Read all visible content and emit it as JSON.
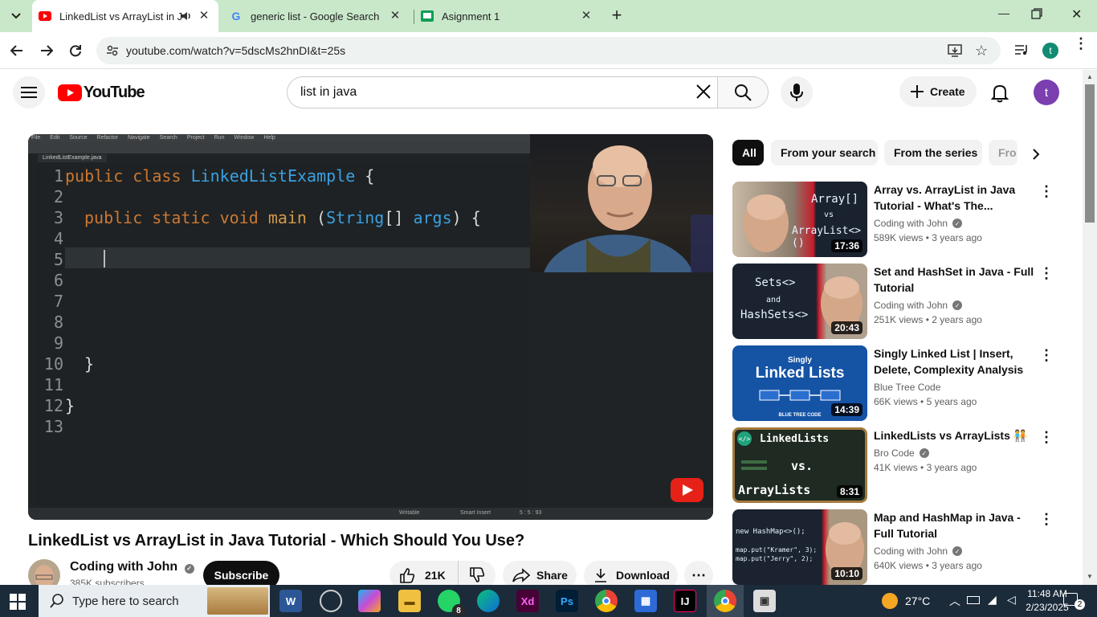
{
  "browser": {
    "tabs": [
      {
        "title": "LinkedList vs ArrayList in Jav",
        "active": true
      },
      {
        "title": "generic list - Google Search",
        "active": false
      },
      {
        "title": "Asignment 1",
        "active": false
      }
    ],
    "url": "youtube.com/watch?v=5dscMs2hnDI&t=25s",
    "profile_initial": "t"
  },
  "youtube": {
    "logo_text": "YouTube",
    "search_query": "list in java",
    "create_label": "Create",
    "avatar_initial": "t"
  },
  "video": {
    "editor_menu": [
      "File",
      "Edit",
      "Source",
      "Refactor",
      "Navigate",
      "Search",
      "Project",
      "Run",
      "Window",
      "Help"
    ],
    "file_tab": "LinkedListExample.java",
    "line_numbers": [
      "1",
      "2",
      "3",
      "4",
      "5",
      "6",
      "7",
      "8",
      "9",
      "10",
      "11",
      "12",
      "13"
    ],
    "status_items": [
      "Writable",
      "Smart Insert",
      "5 : 5 : 93"
    ],
    "title": "LinkedList vs ArrayList in Java Tutorial - Which Should You Use?",
    "channel": "Coding with John",
    "subscribers": "385K subscribers",
    "subscribe_label": "Subscribe",
    "likes": "21K",
    "share_label": "Share",
    "download_label": "Download"
  },
  "chips": [
    "All",
    "From your search",
    "From the series",
    "Fro"
  ],
  "recommendations": [
    {
      "title": "Array vs. ArrayList in Java Tutorial - What's The...",
      "channel": "Coding with John",
      "verified": true,
      "views": "589K views",
      "age": "3 years ago",
      "duration": "17:36",
      "thumb_text": [
        "Array[]",
        "vs",
        "ArrayList<>()"
      ]
    },
    {
      "title": "Set and HashSet in Java - Full Tutorial",
      "channel": "Coding with John",
      "verified": true,
      "views": "251K views",
      "age": "2 years ago",
      "duration": "20:43",
      "thumb_text": [
        "Sets<>",
        "and",
        "HashSets<>"
      ]
    },
    {
      "title": "Singly Linked List | Insert, Delete, Complexity Analysis",
      "channel": "Blue Tree Code",
      "verified": false,
      "views": "66K views",
      "age": "5 years ago",
      "duration": "14:39",
      "thumb_text": [
        "Singly",
        "Linked Lists",
        "BLUE TREE CODE"
      ]
    },
    {
      "title": "LinkedLists vs ArrayLists 🧑‍🤝‍🧑",
      "channel": "Bro Code",
      "verified": true,
      "views": "41K views",
      "age": "3 years ago",
      "duration": "8:31",
      "thumb_text": [
        "LinkedLists",
        "vs.",
        "ArrayLists"
      ]
    },
    {
      "title": "Map and HashMap in Java - Full Tutorial",
      "channel": "Coding with John",
      "verified": true,
      "views": "640K views",
      "age": "3 years ago",
      "duration": "10:10",
      "thumb_text": [
        "new HashMap<>();",
        "map.put(\"Kramer\", 3);",
        "map.put(\"Jerry\", 2);"
      ]
    }
  ],
  "taskbar": {
    "search_placeholder": "Type here to search",
    "whatsapp_badge": "8",
    "temperature": "27°C",
    "time": "11:48 AM",
    "date": "2/23/2025",
    "notifications": "2"
  },
  "colors": {
    "tabstrip": "#c9e8ca",
    "youtube_red": "#ff0000",
    "taskbar": "#1c2b3a"
  }
}
